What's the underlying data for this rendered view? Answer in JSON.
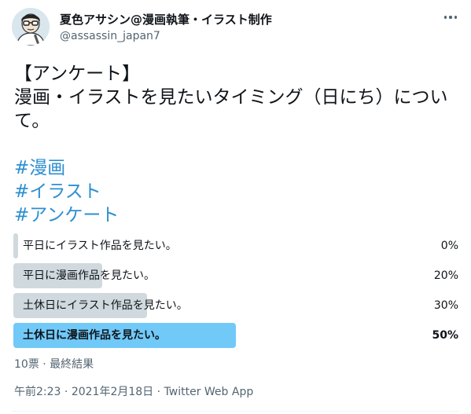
{
  "author": {
    "name": "夏色アサシン@漫画執筆・イラスト制作",
    "handle": "@assassin_japan7"
  },
  "tweet": {
    "lines": [
      "【アンケート】",
      "漫画・イラストを見たいタイミング（日にち）につい",
      "て。"
    ],
    "hashtags": [
      "#漫画",
      "#イラスト",
      "#アンケート"
    ]
  },
  "poll": {
    "options": [
      {
        "label": "平日にイラスト作品を見たい。",
        "percent_text": "0%",
        "percent": 0
      },
      {
        "label": "平日に漫画作品を見たい。",
        "percent_text": "20%",
        "percent": 20
      },
      {
        "label": "土休日にイラスト作品を見たい。",
        "percent_text": "30%",
        "percent": 30
      },
      {
        "label": "土休日に漫画作品を見たい。",
        "percent_text": "50%",
        "percent": 50
      }
    ],
    "meta": "10票 · 最終結果",
    "bar_color": "#cfd9de",
    "winner_color": "#71c9f8"
  },
  "timestamp": {
    "time": "午前2:23",
    "sep1": " · ",
    "date": "2021年2月18日",
    "sep2": " · ",
    "source": "Twitter Web App"
  },
  "colors": {
    "hashtag": "#2e8fd1",
    "secondary_text": "#536471"
  }
}
